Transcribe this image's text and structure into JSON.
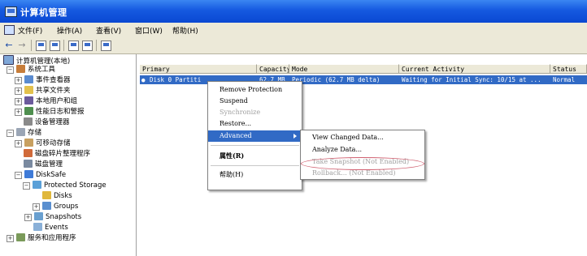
{
  "window": {
    "title": "计算机管理"
  },
  "menubar": {
    "items": [
      {
        "label": "文件(F)"
      },
      {
        "label": "操作(A)"
      },
      {
        "label": "查看(V)"
      },
      {
        "label": "窗口(W)"
      },
      {
        "label": "帮助(H)"
      }
    ]
  },
  "toolbar": {
    "back_icon": "←",
    "forward_icon": "→"
  },
  "tree": {
    "root": "计算机管理(本地)",
    "system_tools": "系统工具",
    "event_viewer": "事件查看器",
    "shared_folders": "共享文件夹",
    "local_users": "本地用户和组",
    "perf_logs": "性能日志和警报",
    "device_manager": "设备管理器",
    "storage": "存储",
    "removable_storage": "可移动存储",
    "defrag": "磁盘碎片整理程序",
    "disk_management": "磁盘管理",
    "disksafe": "DiskSafe",
    "protected_storage": "Protected Storage",
    "disks": "Disks",
    "groups": "Groups",
    "snapshots": "Snapshots",
    "events": "Events",
    "services_apps": "服务和应用程序"
  },
  "list": {
    "columns": [
      "Primary",
      "Capacity",
      "Mode",
      "Current Activity",
      "Status"
    ],
    "rows": [
      {
        "primary": "Disk 0 Partiti",
        "capacity": "62.7 MB",
        "mode": "Periodic (62.7 MB delta)",
        "activity": "Waiting for Initial Sync: 10/15 at ...",
        "status": "Normal"
      }
    ]
  },
  "context_menu": {
    "items": [
      {
        "label": "Remove Protection"
      },
      {
        "label": "Suspend"
      },
      {
        "label": "Synchronize"
      },
      {
        "label": "Restore..."
      },
      {
        "label": "Advanced"
      },
      {
        "label": "属性(R)"
      },
      {
        "label": "帮助(H)"
      }
    ]
  },
  "submenu": {
    "items": [
      {
        "label": "View Changed Data..."
      },
      {
        "label": "Analyze Data..."
      },
      {
        "label": "Take Snapshot (Not Enabled)"
      },
      {
        "label": "Rollback... (Not Enabled)"
      }
    ]
  }
}
